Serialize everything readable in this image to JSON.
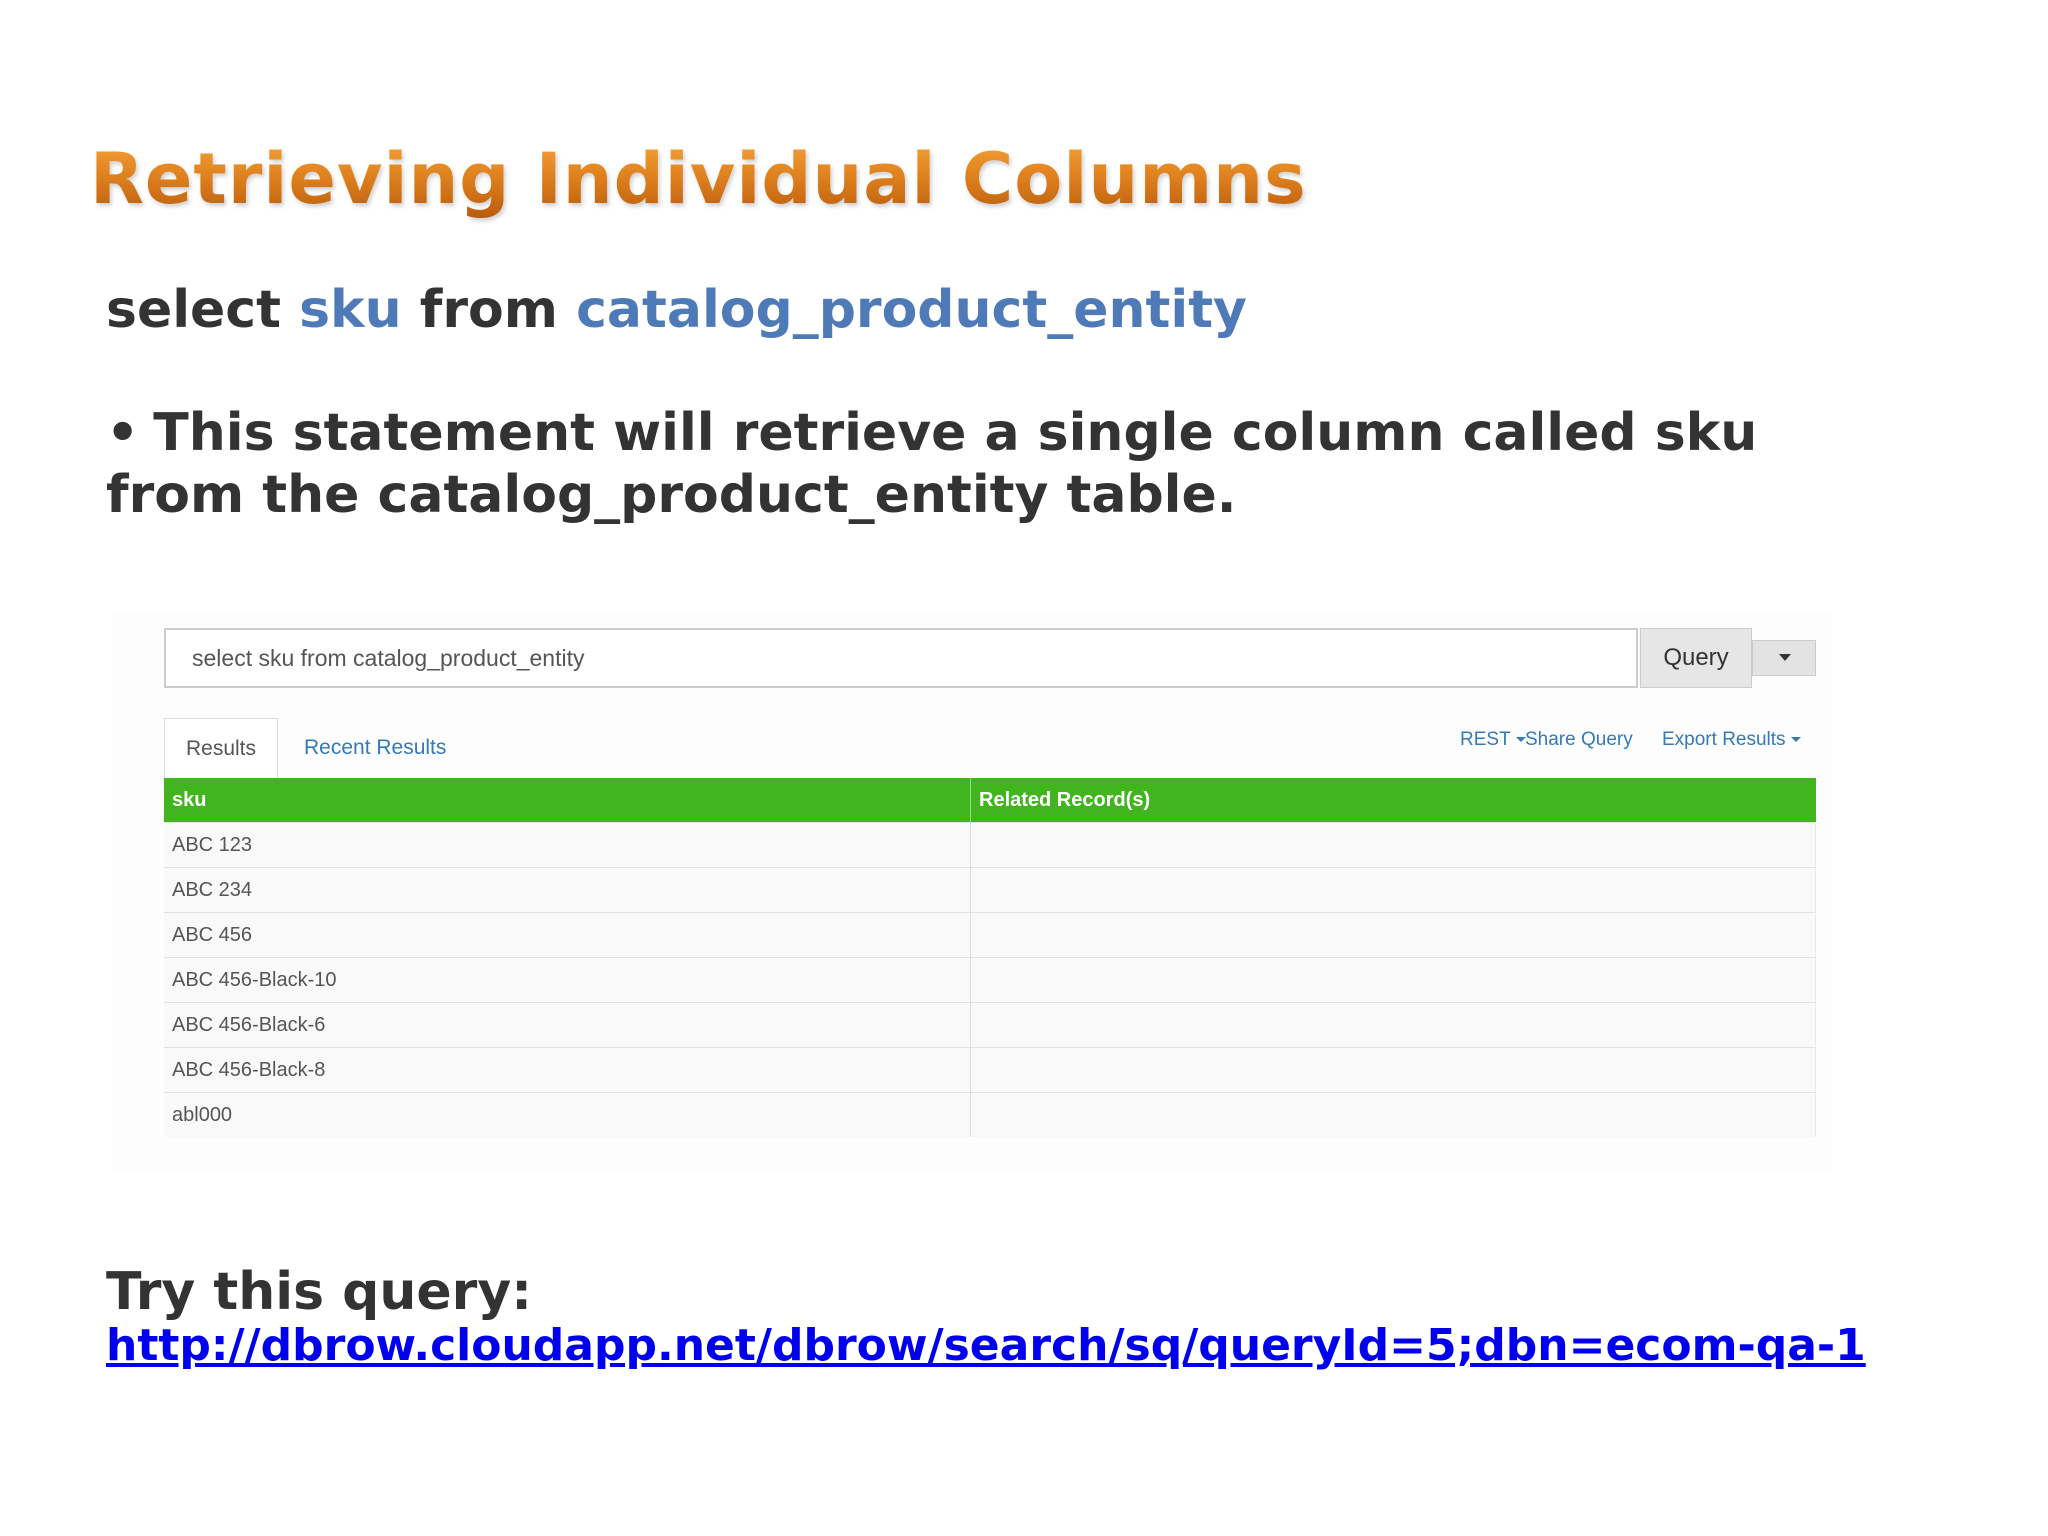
{
  "slide": {
    "title": "Retrieving Individual Columns",
    "sql": {
      "kw_select": "select",
      "column": "sku",
      "kw_from": "from",
      "table": "catalog_product_entity"
    },
    "bullet_char": "•",
    "bullet_text": "This statement will retrieve a single column called sku from the catalog_product_entity table.",
    "try_label": "Try this query:",
    "try_link": "http://dbrow.cloudapp.net/dbrow/search/sq/queryId=5;dbn=ecom-qa-1"
  },
  "ui": {
    "query_input_value": "select sku from catalog_product_entity",
    "query_button": "Query",
    "tabs": [
      "Results",
      "Recent Results"
    ],
    "toolbar": {
      "rest": "REST",
      "share": "Share Query",
      "export": "Export Results"
    },
    "table": {
      "headers": [
        "sku",
        "Related Record(s)"
      ],
      "rows": [
        [
          "ABC 123",
          ""
        ],
        [
          "ABC 234",
          ""
        ],
        [
          "ABC 456",
          ""
        ],
        [
          "ABC 456-Black-10",
          ""
        ],
        [
          "ABC 456-Black-6",
          ""
        ],
        [
          "ABC 456-Black-8",
          ""
        ],
        [
          "abl000",
          ""
        ]
      ]
    },
    "colors": {
      "header_green": "#41b51d",
      "link_blue": "#337ab7",
      "title_orange": "#e0821e",
      "sql_blue": "#4e7ab7"
    }
  }
}
